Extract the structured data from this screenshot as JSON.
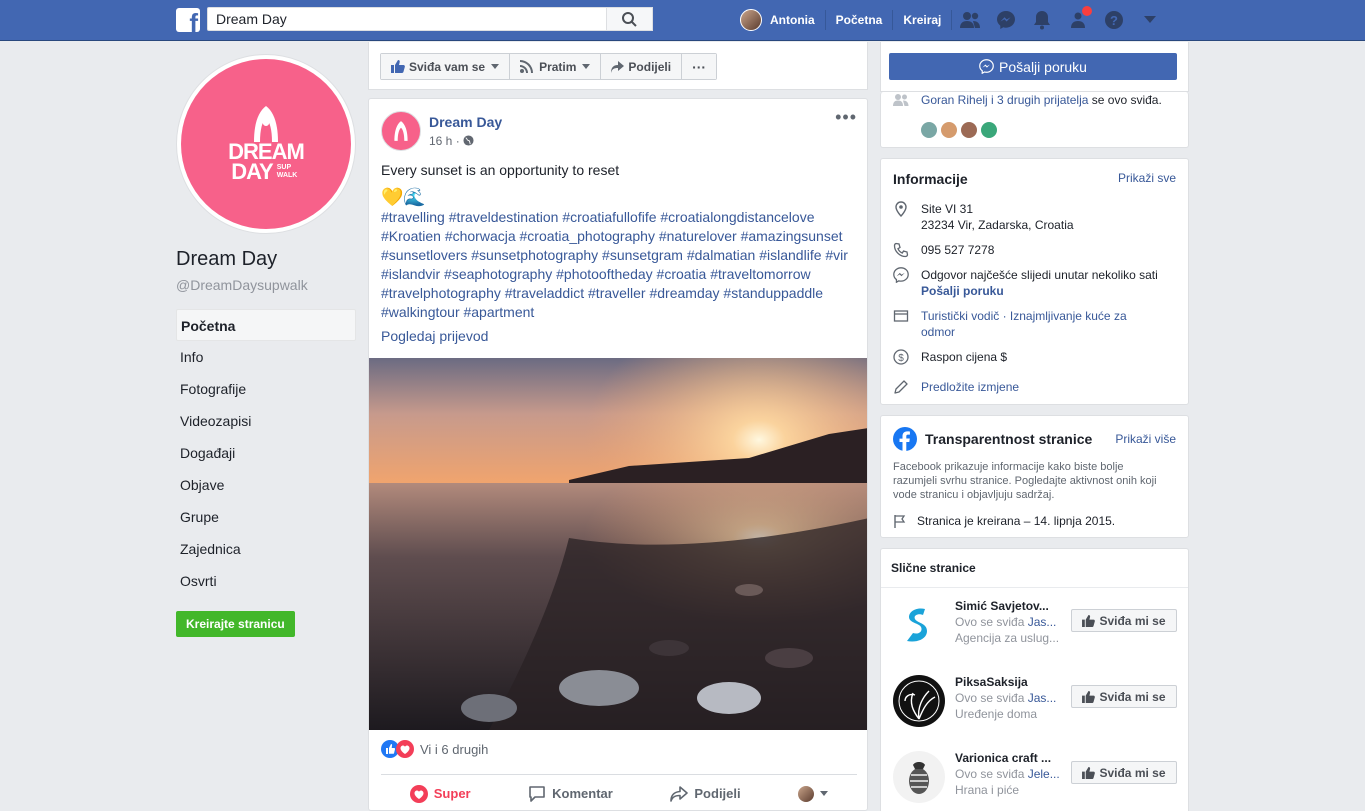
{
  "topbar": {
    "logo": "f",
    "search_value": "Dream Day",
    "user_name": "Antonia",
    "home": "Početna",
    "create": "Kreiraj"
  },
  "left": {
    "logo_line1": "DREAM",
    "logo_line2": "DAY",
    "logo_sub": "SUP WALK",
    "page_name": "Dream Day",
    "page_handle": "@DreamDaysupwalk",
    "nav": [
      "Početna",
      "Info",
      "Fotografije",
      "Videozapisi",
      "Događaji",
      "Objave",
      "Grupe",
      "Zajednica",
      "Osvrti"
    ],
    "create_page": "Kreirajte stranicu"
  },
  "toolbar": {
    "like": "Sviđa vam se",
    "follow": "Pratim",
    "share": "Podijeli",
    "more": "···"
  },
  "send_message": "Pošalji poruku",
  "post": {
    "author": "Dream Day",
    "time": "16 h ·",
    "text": "Every sunset is an opportunity to reset",
    "emoji": "💛🌊",
    "hashtags": "#travelling #traveldestination #croatiafullofife #croatialongdistancelove #Kroatien #chorwacja #croatia_photography #naturelover #amazingsunset #sunsetlovers #sunsetphotography #sunsetgram #dalmatian #islandlife #vir #islandvir #seaphotography #photooftheday #croatia #traveltomorrow #travelphotography #traveladdict #traveller #dreamday #standuppaddle #walkingtour #apartment",
    "translate": "Pogledaj prijevod",
    "reactions_text": "Vi i 6 drugih",
    "actions": {
      "super": "Super",
      "comment": "Komentar",
      "share": "Podijeli"
    }
  },
  "friends_card": {
    "names": "Goran Rihelj i 3 drugih prijatelja",
    "suffix": " se ovo sviđa."
  },
  "info_card": {
    "title": "Informacije",
    "show_all": "Prikaži sve",
    "address1": "Site VI 31",
    "address2": "23234 Vir, Zadarska, Croatia",
    "phone": "095 527 7278",
    "response": "Odgovor najčešće slijedi unutar nekoliko sati",
    "send_msg": "Pošalji poruku",
    "categories": "Turistički vodič · Iznajmljivanje kuće za odmor",
    "price": "Raspon cijena $",
    "suggest": "Predložite izmjene"
  },
  "transparency_card": {
    "title": "Transparentnost stranice",
    "show_more": "Prikaži više",
    "desc": "Facebook prikazuje informacije kako biste bolje razumjeli svrhu stranice. Pogledajte aktivnost onih koji vode stranicu i objavljuju sadržaj.",
    "created": "Stranica je kreirana – 14. lipnja 2015."
  },
  "similar_card": {
    "title": "Slične stranice",
    "like_label": "Sviđa mi se",
    "items": [
      {
        "name": "Simić Savjetov...",
        "liked_by": "Ovo se sviđa ",
        "liked_name": "Jas...",
        "category": "Agencija za uslug..."
      },
      {
        "name": "PiksaSaksija",
        "liked_by": "Ovo se sviđa ",
        "liked_name": "Jas...",
        "category": "Uređenje doma"
      },
      {
        "name": "Varionica craft ...",
        "liked_by": "Ovo se sviđa ",
        "liked_name": "Jele...",
        "category": "Hrana i piće"
      }
    ]
  },
  "colors": {
    "fb_blue": "#4267b2",
    "brand_pink": "#f7618a",
    "link": "#385898",
    "green": "#42b72a"
  }
}
